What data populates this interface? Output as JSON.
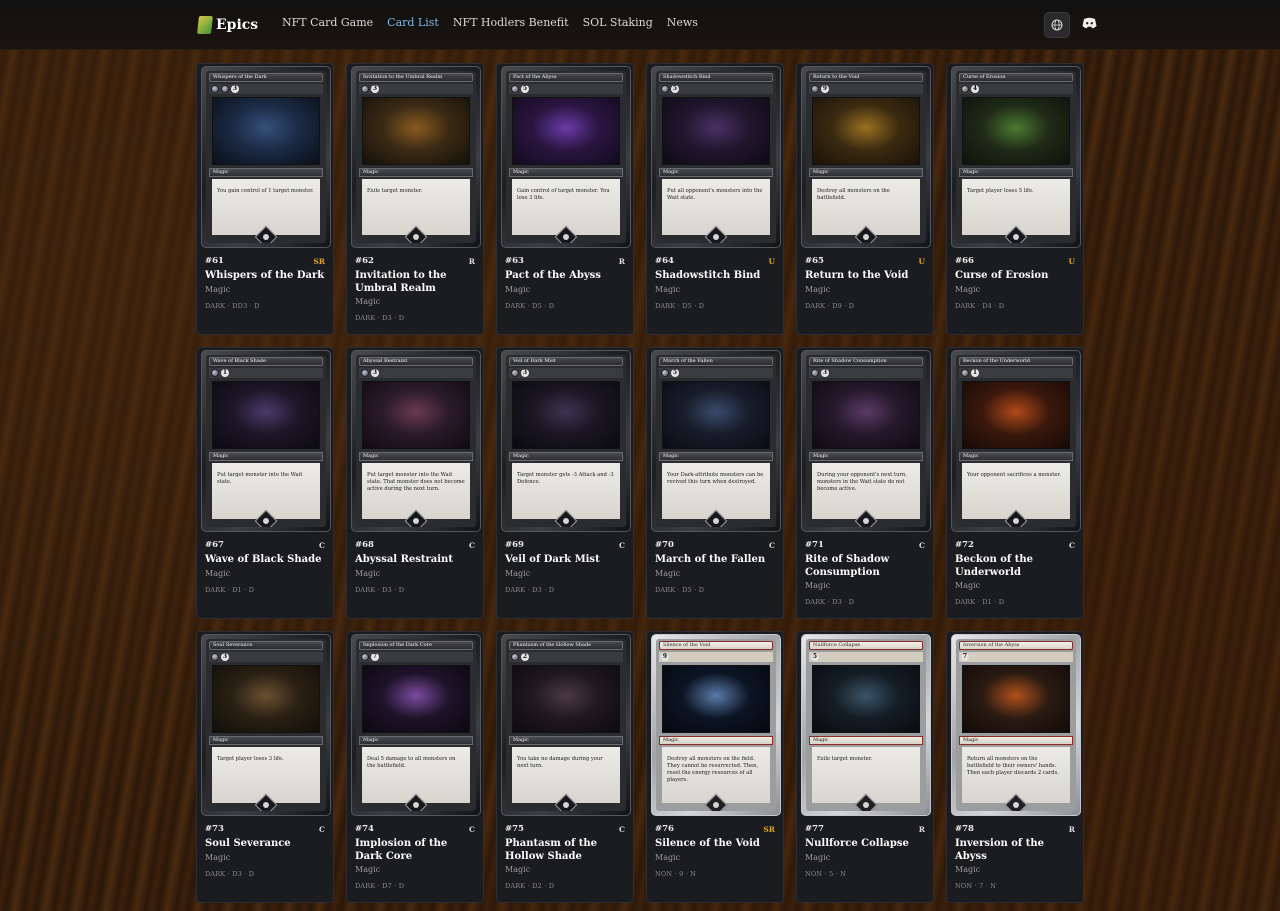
{
  "header": {
    "logo_text": "Epics",
    "nav": [
      {
        "label": "NFT Card Game",
        "active": false
      },
      {
        "label": "Card List",
        "active": true
      },
      {
        "label": "NFT Hodlers Benefit",
        "active": false
      },
      {
        "label": "SOL Staking",
        "active": false
      },
      {
        "label": "News",
        "active": false
      }
    ],
    "icons": {
      "language": "globe-icon",
      "discord": "discord-icon"
    }
  },
  "cards": [
    {
      "num": "#61",
      "name": "Whispers of the Dark",
      "type": "Magic",
      "rarity": "SR",
      "stats": "DARK · DD3 · D",
      "cost": "3",
      "orbs": 2,
      "text": "You gain control of 1 target monster.",
      "frame": "dark",
      "art": [
        "#1b2a45",
        "#35507a",
        "#0b0f18"
      ]
    },
    {
      "num": "#62",
      "name": "Invitation to the Umbral Realm",
      "type": "Magic",
      "rarity": "R",
      "stats": "DARK · D3 · D",
      "cost": "3",
      "orbs": 1,
      "text": "Exile target monster.",
      "frame": "dark",
      "art": [
        "#3a2a14",
        "#8a5a20",
        "#15100a"
      ]
    },
    {
      "num": "#63",
      "name": "Pact of the Abyss",
      "type": "Magic",
      "rarity": "R",
      "stats": "DARK · D5 · D",
      "cost": "5",
      "orbs": 1,
      "text": "Gain control of target monster. You lose 3 life.",
      "frame": "dark",
      "art": [
        "#2a1540",
        "#6a3aa8",
        "#120a1c"
      ]
    },
    {
      "num": "#64",
      "name": "Shadowstitch Bind",
      "type": "Magic",
      "rarity": "U",
      "stats": "DARK · D5 · D",
      "cost": "5",
      "orbs": 1,
      "text": "Put all opponent's monsters into the Wait state.",
      "frame": "dark",
      "art": [
        "#21162e",
        "#4a3066",
        "#0e0a14"
      ]
    },
    {
      "num": "#65",
      "name": "Return to the Void",
      "type": "Magic",
      "rarity": "U",
      "stats": "DARK · D9 · D",
      "cost": "9",
      "orbs": 1,
      "text": "Destroy all monsters on the battlefield.",
      "frame": "dark",
      "art": [
        "#3a2a10",
        "#9a7022",
        "#1a1208"
      ]
    },
    {
      "num": "#66",
      "name": "Curse of Erosion",
      "type": "Magic",
      "rarity": "U",
      "stats": "DARK · D4 · D",
      "cost": "4",
      "orbs": 1,
      "text": "Target player loses 5 life.",
      "frame": "dark",
      "art": [
        "#1f2a18",
        "#4c7a30",
        "#0e120a"
      ]
    },
    {
      "num": "#67",
      "name": "Wave of Black Shade",
      "type": "Magic",
      "rarity": "C",
      "stats": "DARK · D1 · D",
      "cost": "1",
      "orbs": 1,
      "text": "Put target monster into the Wait state.",
      "frame": "dark",
      "art": [
        "#1c1626",
        "#4a3a6a",
        "#0c0a12"
      ]
    },
    {
      "num": "#68",
      "name": "Abyssal Restraint",
      "type": "Magic",
      "rarity": "C",
      "stats": "DARK · D3 · D",
      "cost": "3",
      "orbs": 1,
      "text": "Put target monster into the Wait state. That monster does not become active during the next turn.",
      "frame": "dark",
      "art": [
        "#2a1a2a",
        "#6a3a50",
        "#120a10"
      ]
    },
    {
      "num": "#69",
      "name": "Veil of Dark Mist",
      "type": "Magic",
      "rarity": "C",
      "stats": "DARK · D3 · D",
      "cost": "3",
      "orbs": 1,
      "text": "Target monster gets -3 Attack and -3 Defence.",
      "frame": "dark",
      "art": [
        "#1a1622",
        "#3c3450",
        "#0a0a10"
      ]
    },
    {
      "num": "#70",
      "name": "March of the Fallen",
      "type": "Magic",
      "rarity": "C",
      "stats": "DARK · D5 · D",
      "cost": "5",
      "orbs": 1,
      "text": "Your Dark-attribute monsters can be revived this turn when destroyed.",
      "frame": "dark",
      "art": [
        "#161c2a",
        "#3a4a6a",
        "#0a0c12"
      ]
    },
    {
      "num": "#71",
      "name": "Rite of Shadow Consumption",
      "type": "Magic",
      "rarity": "C",
      "stats": "DARK · D3 · D",
      "cost": "3",
      "orbs": 1,
      "text": "During your opponent's next turn, monsters in the Wait state do not become active.",
      "frame": "dark",
      "art": [
        "#24182a",
        "#5a3a66",
        "#100a12"
      ]
    },
    {
      "num": "#72",
      "name": "Beckon of the Underworld",
      "type": "Magic",
      "rarity": "C",
      "stats": "DARK · D1 · D",
      "cost": "1",
      "orbs": 1,
      "text": "Your opponent sacrifices a monster.",
      "frame": "dark",
      "art": [
        "#3a180c",
        "#b04a18",
        "#160a06"
      ]
    },
    {
      "num": "#73",
      "name": "Soul Severance",
      "type": "Magic",
      "rarity": "C",
      "stats": "DARK · D3 · D",
      "cost": "3",
      "orbs": 1,
      "text": "Target player loses 3 life.",
      "frame": "dark",
      "art": [
        "#2a2014",
        "#6a5030",
        "#120e08"
      ]
    },
    {
      "num": "#74",
      "name": "Implosion of the Dark Core",
      "type": "Magic",
      "rarity": "C",
      "stats": "DARK · D7 · D",
      "cost": "7",
      "orbs": 1,
      "text": "Deal 5 damage to all monsters on the battlefield.",
      "frame": "dark",
      "art": [
        "#1e1228",
        "#7a4aa0",
        "#0c0810"
      ]
    },
    {
      "num": "#75",
      "name": "Phantasm of the Hollow Shade",
      "type": "Magic",
      "rarity": "C",
      "stats": "DARK · D2 · D",
      "cost": "2",
      "orbs": 1,
      "text": "You take no damage during your next turn.",
      "frame": "dark",
      "art": [
        "#20181e",
        "#4a3a44",
        "#0c0a0c"
      ]
    },
    {
      "num": "#76",
      "name": "Silence of the Void",
      "type": "Magic",
      "rarity": "SR",
      "stats": "NON · 9 · N",
      "cost": "9",
      "orbs": 0,
      "text": "Destroy all monsters on the field. They cannot be resurrected. Then, reset the energy resources of all players.",
      "frame": "silver",
      "art": [
        "#0c1424",
        "#5a7aa8",
        "#05080e"
      ]
    },
    {
      "num": "#77",
      "name": "Nullforce Collapse",
      "type": "Magic",
      "rarity": "R",
      "stats": "NON · 5 · N",
      "cost": "5",
      "orbs": 0,
      "text": "Exile target monster.",
      "frame": "silver",
      "art": [
        "#141c24",
        "#3a5468",
        "#080c10"
      ]
    },
    {
      "num": "#78",
      "name": "Inversion of the Abyss",
      "type": "Magic",
      "rarity": "R",
      "stats": "NON · 7 · N",
      "cost": "7",
      "orbs": 0,
      "text": "Return all monsters on the battlefield to their owners' hands. Then each player discards 2 cards.",
      "frame": "silver",
      "art": [
        "#2a1a12",
        "#b0521c",
        "#120a08"
      ]
    }
  ]
}
